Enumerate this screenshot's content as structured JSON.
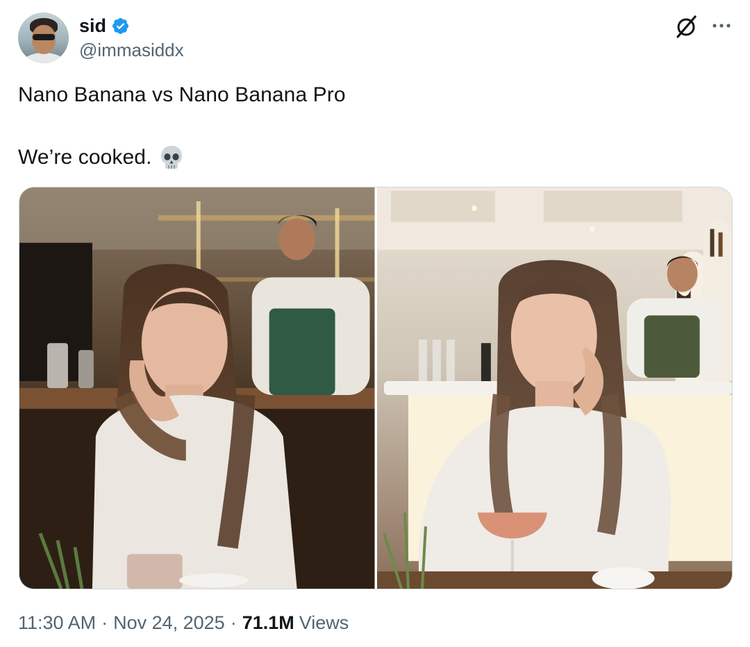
{
  "author": {
    "display_name": "sid",
    "handle": "@immasiddx",
    "verified": true,
    "verified_color": "#1d9bf0"
  },
  "tweet": {
    "line1": "Nano Banana vs Nano Banana Pro",
    "line2": "We’re cooked.",
    "emoji": "skull"
  },
  "media": [
    {
      "icon": "photo-image"
    },
    {
      "icon": "photo-image"
    }
  ],
  "meta": {
    "time": "11:30 AM",
    "date": "Nov 24, 2025",
    "views_count": "71.1M",
    "views_label": "Views",
    "separator": "·"
  },
  "colors": {
    "text_primary": "#0f1419",
    "text_secondary": "#536471",
    "border": "#cfd9de"
  }
}
